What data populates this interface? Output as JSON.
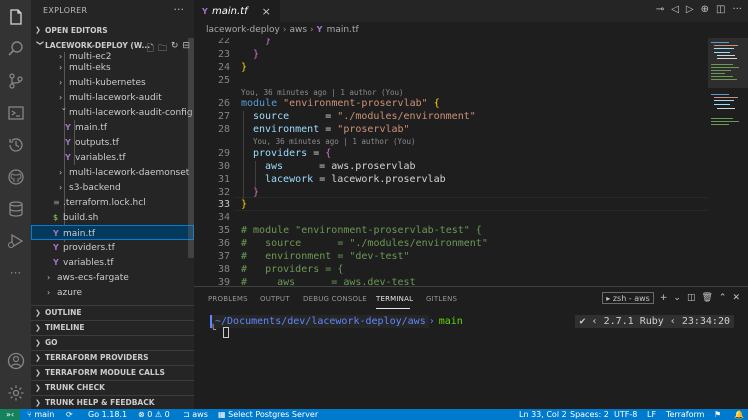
{
  "sidebar": {
    "title": "EXPLORER",
    "more": "···",
    "open_editors": "OPEN EDITORS",
    "workspace": "LACEWORK-DEPLOY (W...",
    "tree": [
      {
        "label": "multi-ec2",
        "kind": "folder",
        "open": false
      },
      {
        "label": "multi-eks",
        "kind": "folder",
        "open": false
      },
      {
        "label": "multi-kubernetes",
        "kind": "folder",
        "open": false
      },
      {
        "label": "multi-lacework-audit",
        "kind": "folder",
        "open": false
      },
      {
        "label": "multi-lacework-audit-config",
        "kind": "folder",
        "open": true
      },
      {
        "label": "main.tf",
        "kind": "tf"
      },
      {
        "label": "outputs.tf",
        "kind": "tf"
      },
      {
        "label": "variables.tf",
        "kind": "tf"
      },
      {
        "label": "multi-lacework-daemonset",
        "kind": "folder",
        "open": false
      },
      {
        "label": "s3-backend",
        "kind": "folder",
        "open": false
      },
      {
        "label": ".terraform.lock.hcl",
        "kind": "lock"
      },
      {
        "label": "build.sh",
        "kind": "sh"
      },
      {
        "label": "main.tf",
        "kind": "tf",
        "selected": true
      },
      {
        "label": "providers.tf",
        "kind": "tf"
      },
      {
        "label": "variables.tf",
        "kind": "tf"
      },
      {
        "label": "aws-ecs-fargate",
        "kind": "folder",
        "open": false
      },
      {
        "label": "azure",
        "kind": "folder",
        "open": false
      }
    ],
    "sections": [
      "OUTLINE",
      "TIMELINE",
      "GO",
      "TERRAFORM PROVIDERS",
      "TERRAFORM MODULE CALLS",
      "TRUNK CHECK",
      "TRUNK HELP & FEEDBACK"
    ]
  },
  "editor": {
    "tab_label": "main.tf",
    "tab_close": "×",
    "breadcrumb": [
      "lacework-deploy",
      "aws",
      "main.tf"
    ],
    "blame_1": "You, 36 minutes ago | 1 author (You)",
    "blame_2": "You, 36 minutes ago | 1 author (You)",
    "lines": {
      "n22": "22",
      "n23": "23",
      "n24": "24",
      "n25": "25",
      "n26": "26",
      "n27": "27",
      "n28": "28",
      "n29": "29",
      "n30": "30",
      "n31": "31",
      "n32": "32",
      "n33": "33",
      "n34": "34",
      "n35": "35",
      "n36": "36",
      "n37": "37",
      "n38": "38",
      "n39": "39"
    },
    "code": {
      "l22": "}",
      "l23": "}",
      "l24": "}",
      "l26_kw": "module",
      "l26_str": "\"environment-proservlab\"",
      "l26_br": "{",
      "l27_key": "source",
      "l27_eq": "      = ",
      "l27_val": "\"./modules/environment\"",
      "l28_key": "environment",
      "l28_eq": " = ",
      "l28_val": "\"proservlab\"",
      "l29_key": "providers",
      "l29_eq": " = ",
      "l29_br": "{",
      "l30_key": "aws",
      "l30_rest": "      = aws.proservlab",
      "l31_key": "lacework",
      "l31_rest": " = lacework.proservlab",
      "l32": "}",
      "l33": "}",
      "l35": "# module \"environment-proservlab-test\" {",
      "l36": "#   source      = \"./modules/environment\"",
      "l37": "#   environment = \"dev-test\"",
      "l38": "#   providers = {",
      "l39": "#     aws      = aws.dev-test"
    }
  },
  "panel": {
    "tabs": [
      "PROBLEMS",
      "OUTPUT",
      "DEBUG CONSOLE",
      "TERMINAL",
      "GITLENS"
    ],
    "active_tab": "TERMINAL",
    "terminal_selector": "zsh - aws",
    "add": "+",
    "path": "~/Documents/dev/lacework-deploy/aws",
    "branch": "main",
    "ruby": "✔ ‹ 2.7.1 Ruby ‹ 23:34:20"
  },
  "status": {
    "remote": "»‹",
    "branch": "main",
    "sync": "⟳",
    "go_version": "Go 1.18.1",
    "problems": "⊗ 0 ⚠ 0",
    "folder": "aws",
    "db": "Select Postgres Server",
    "position": "Ln 33, Col 2",
    "spaces": "Spaces: 2",
    "encoding": "UTF-8",
    "eol": "LF",
    "language": "Terraform"
  },
  "colors": {
    "accent": "#007acc",
    "selection": "#04395e",
    "terraform": "#a074c4"
  }
}
